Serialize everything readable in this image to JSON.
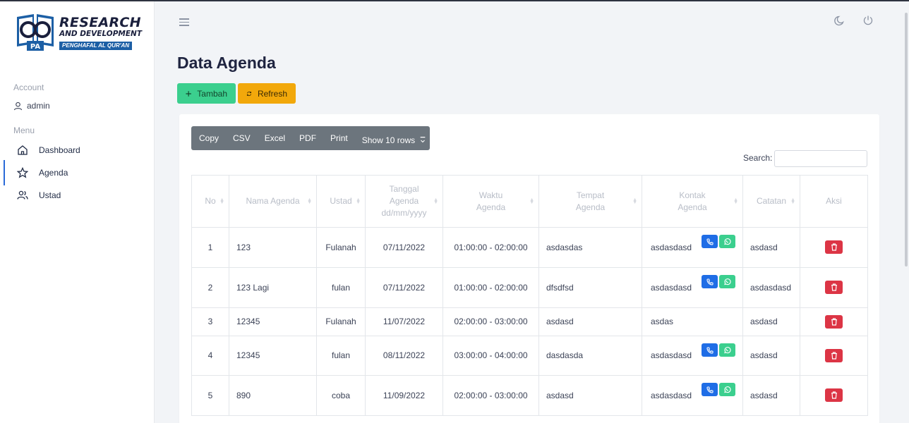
{
  "brand": {
    "line1": "RESEARCH",
    "line2": "AND DEVELOPMENT",
    "line3": "PENGHAFAL AL QUR'AN"
  },
  "sidebar": {
    "account_label": "Account",
    "user": "admin",
    "menu_label": "Menu",
    "items": [
      {
        "label": "Dashboard",
        "icon": "home-icon",
        "active": false
      },
      {
        "label": "Agenda",
        "icon": "star-icon",
        "active": true
      },
      {
        "label": "Ustad",
        "icon": "users-icon",
        "active": false
      }
    ]
  },
  "header": {
    "theme_icon": "moon-icon",
    "power_icon": "power-icon"
  },
  "page": {
    "title": "Data Agenda",
    "add_label": "Tambah",
    "refresh_label": "Refresh"
  },
  "table_tools": {
    "buttons": [
      "Copy",
      "CSV",
      "Excel",
      "PDF",
      "Print"
    ],
    "show_rows": "Show 10 rows",
    "search_label": "Search:",
    "search_value": ""
  },
  "table": {
    "headers": [
      "No",
      "Nama Agenda",
      "Ustad",
      "Tanggal Agenda dd/mm/yyyy",
      "Waktu Agenda",
      "Tempat Agenda",
      "Kontak Agenda",
      "Catatan",
      "Aksi"
    ],
    "rows": [
      {
        "no": "1",
        "nama": "123",
        "ustad": "Fulanah",
        "tanggal": "07/11/2022",
        "waktu": "01:00:00 - 02:00:00",
        "tempat": "asdasdas",
        "kontak": "asdasdasd",
        "kontak_buttons": true,
        "catatan": "asdasd"
      },
      {
        "no": "2",
        "nama": "123 Lagi",
        "ustad": "fulan",
        "tanggal": "07/11/2022",
        "waktu": "01:00:00 - 02:00:00",
        "tempat": "dfsdfsd",
        "kontak": "asdasdasd",
        "kontak_buttons": true,
        "catatan": "asdasdasd"
      },
      {
        "no": "3",
        "nama": "12345",
        "ustad": "Fulanah",
        "tanggal": "11/07/2022",
        "waktu": "02:00:00 - 03:00:00",
        "tempat": "asdasd",
        "kontak": "asdas",
        "kontak_buttons": false,
        "catatan": "asdasd"
      },
      {
        "no": "4",
        "nama": "12345",
        "ustad": "fulan",
        "tanggal": "08/11/2022",
        "waktu": "03:00:00 - 04:00:00",
        "tempat": "dasdasda",
        "kontak": "asdasdasd",
        "kontak_buttons": true,
        "catatan": "asdasd"
      },
      {
        "no": "5",
        "nama": "890",
        "ustad": "coba",
        "tanggal": "11/09/2022",
        "waktu": "02:00:00 - 03:00:00",
        "tempat": "asdasd",
        "kontak": "asdasdasd",
        "kontak_buttons": true,
        "catatan": "asdasd"
      }
    ]
  },
  "colors": {
    "primary": "#1f6de6",
    "success": "#3bcf8e",
    "warning": "#f2a80b",
    "danger": "#dc3545",
    "secondary": "#6c757d"
  }
}
